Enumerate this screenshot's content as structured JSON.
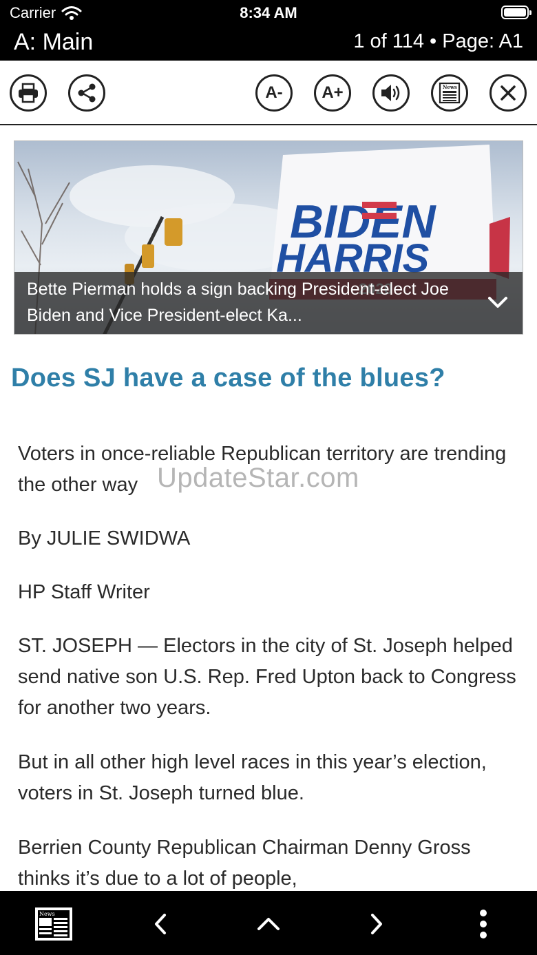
{
  "status": {
    "carrier": "Carrier",
    "time": "8:34 AM"
  },
  "header": {
    "section": "A: Main",
    "position": "1 of 114 • Page: A1"
  },
  "toolbar": {
    "font_decrease": "A-",
    "font_increase": "A+",
    "news_icon_label": "News"
  },
  "hero": {
    "sign_line1": "BIDEN",
    "sign_line2": "HARRIS",
    "sign_year": "2020",
    "caption": "Bette Pierman holds a sign backing President-elect Joe Biden and Vice President-elect Ka..."
  },
  "article": {
    "headline": "Does SJ have a case of the blues?",
    "subhead": "Voters in once-reliable Republican territory are trending the other way",
    "byline": "By JULIE SWIDWA",
    "role": "HP Staff Writer",
    "p1": "ST. JOSEPH — Electors in the city of St. Joseph helped send native son U.S. Rep. Fred Upton back to Congress for another two years.",
    "p2": "But in all other high level races in this year’s election, voters in St. Joseph turned blue.",
    "p3": "Berrien County Republican Chairman Denny Gross thinks it’s due to a lot of people,"
  },
  "watermark": "UpdateStar.com",
  "bottom": {
    "news_label": "News"
  },
  "colors": {
    "headline": "#2f7fa8",
    "bar": "#000000",
    "sign_blue": "#1f4fa3",
    "sign_red": "#d23a4a"
  }
}
